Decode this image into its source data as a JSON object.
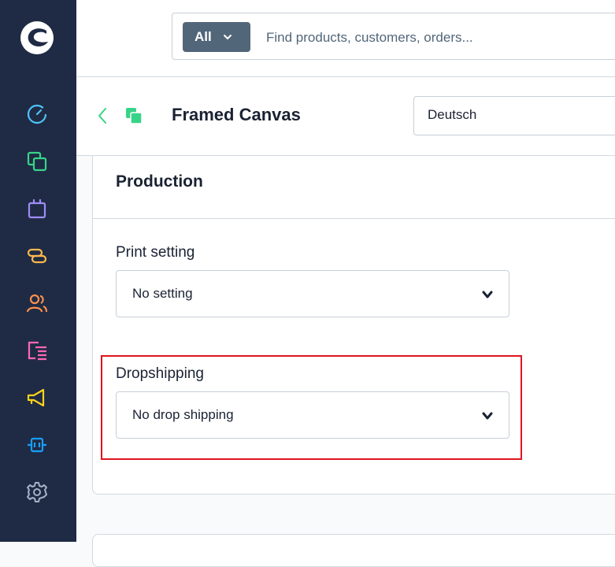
{
  "colors": {
    "sidebar_bg": "#1f2b44",
    "accent_green": "#37d488",
    "highlight_red": "#e0141e",
    "scope_button_bg": "#52667a"
  },
  "sidebar": {
    "logo_icon": "shopware-logo-icon",
    "items": [
      {
        "name": "dashboard-icon",
        "color": "#4fc3f7"
      },
      {
        "name": "catalogues-icon",
        "color": "#37d488"
      },
      {
        "name": "orders-icon",
        "color": "#9f8cf7"
      },
      {
        "name": "customers-link-icon",
        "color": "#ffb84d"
      },
      {
        "name": "customers-icon",
        "color": "#ff8f4d"
      },
      {
        "name": "content-icon",
        "color": "#ff68b4"
      },
      {
        "name": "marketing-icon",
        "color": "#ffd11a"
      },
      {
        "name": "extensions-icon",
        "color": "#189eff"
      },
      {
        "name": "settings-icon",
        "color": "#a4b3c6"
      }
    ]
  },
  "search": {
    "scope_label": "All",
    "placeholder": "Find products, customers, orders..."
  },
  "header": {
    "title": "Framed Canvas",
    "language": "Deutsch"
  },
  "card": {
    "title": "Production",
    "print_setting": {
      "label": "Print setting",
      "value": "No setting"
    },
    "dropshipping": {
      "label": "Dropshipping",
      "value": "No drop shipping"
    }
  }
}
